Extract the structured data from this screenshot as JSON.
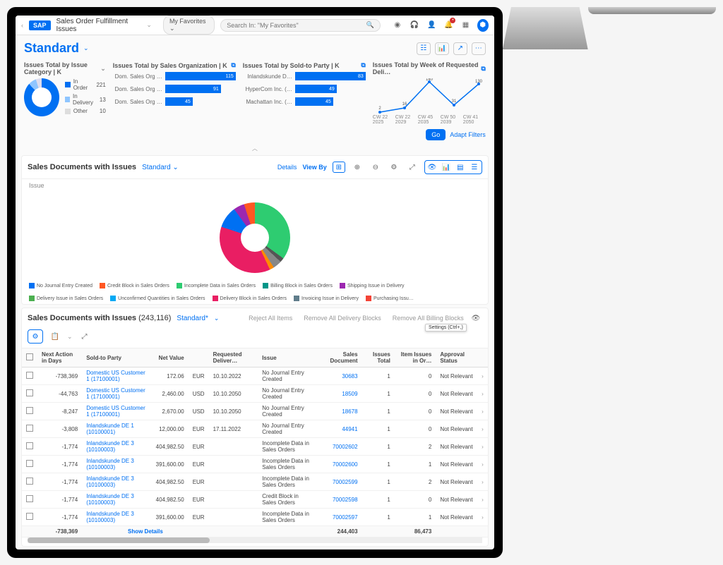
{
  "shell": {
    "app_title": "Sales Order Fulfillment Issues",
    "favorites_label": "My Favorites",
    "search_placeholder": "Search In: \"My Favorites\""
  },
  "page_title": "Standard",
  "chart_data": [
    {
      "type": "pie",
      "title": "Issues Total by Issue Category | K",
      "series": [
        {
          "name": "In Order",
          "value": 221,
          "color": "#0070f2"
        },
        {
          "name": "In Delivery",
          "value": 13,
          "color": "#8ec5ff"
        },
        {
          "name": "Other",
          "value": 10,
          "color": "#ddd"
        }
      ]
    },
    {
      "type": "bar",
      "title": "Issues Total by Sales Organization | K",
      "categories": [
        "Dom. Sales Org …",
        "Dom. Sales Org …",
        "Dom. Sales Org …"
      ],
      "values": [
        115,
        91,
        45
      ]
    },
    {
      "type": "bar",
      "title": "Issues Total by Sold-to Party | K",
      "categories": [
        "Inlandskunde D…",
        "HyperCom Inc. (…",
        "Machattan Inc. (…"
      ],
      "values": [
        83,
        49,
        45
      ]
    },
    {
      "type": "line",
      "title": "Issues Total by Week of Requested Deli…",
      "x": [
        "CW 22 2025",
        "CW 22 2029",
        "CW 45 2035",
        "CW 50 2039",
        "CW 41 2050"
      ],
      "values": [
        2,
        16,
        140,
        31,
        130
      ],
      "labels": [
        "2",
        "16",
        "140",
        "31",
        "130"
      ]
    }
  ],
  "filters": {
    "go": "Go",
    "adapt": "Adapt Filters"
  },
  "section1": {
    "title": "Sales Documents with Issues",
    "variant": "Standard",
    "details": "Details",
    "view_by": "View By",
    "issue_label": "Issue"
  },
  "donut_legend": [
    {
      "label": "No Journal Entry Created",
      "color": "#0070f2"
    },
    {
      "label": "Credit Block in Sales Orders",
      "color": "#ff5722"
    },
    {
      "label": "Incomplete Data in Sales Orders",
      "color": "#2ecc71"
    },
    {
      "label": "Billing Block in Sales Orders",
      "color": "#009688"
    },
    {
      "label": "Shipping Issue in Delivery",
      "color": "#9c27b0"
    },
    {
      "label": "Delivery Issue in Sales Orders",
      "color": "#4caf50"
    },
    {
      "label": "Unconfirmed Quantities in Sales Orders",
      "color": "#03a9f4"
    },
    {
      "label": "Delivery Block in Sales Orders",
      "color": "#e91e63"
    },
    {
      "label": "Invoicing Issue in Delivery",
      "color": "#607d8b"
    },
    {
      "label": "Purchasing Issu…",
      "color": "#f44336"
    }
  ],
  "table": {
    "title": "Sales Documents with Issues",
    "count": "(243,116)",
    "variant": "Standard",
    "reject": "Reject All Items",
    "remove_delivery": "Remove All Delivery Blocks",
    "remove_billing": "Remove All Billing Blocks",
    "tooltip": "Settings (Ctrl+,)",
    "columns": {
      "next_action": "Next Action in Days",
      "sold_to": "Sold-to Party",
      "net_value": "Net Value",
      "currency": "",
      "req_deliv": "Requested Deliver…",
      "issue": "Issue",
      "sales_doc": "Sales Document",
      "issues_total": "Issues Total",
      "item_issues": "Item Issues in Or…",
      "approval": "Approval Status"
    },
    "rows": [
      {
        "days": "-738,369",
        "party": "Domestic US Customer 1 (17100001)",
        "net": "172.06",
        "cur": "EUR",
        "date": "10.10.2022",
        "issue": "No Journal Entry Created",
        "doc": "30683",
        "tot": "1",
        "item": "0",
        "appr": "Not Relevant"
      },
      {
        "days": "-44,763",
        "party": "Domestic US Customer 1 (17100001)",
        "net": "2,460.00",
        "cur": "USD",
        "date": "10.10.2050",
        "issue": "No Journal Entry Created",
        "doc": "18509",
        "tot": "1",
        "item": "0",
        "appr": "Not Relevant"
      },
      {
        "days": "-8,247",
        "party": "Domestic US Customer 1 (17100001)",
        "net": "2,670.00",
        "cur": "USD",
        "date": "10.10.2050",
        "issue": "No Journal Entry Created",
        "doc": "18678",
        "tot": "1",
        "item": "0",
        "appr": "Not Relevant"
      },
      {
        "days": "-3,808",
        "party": "Inlandskunde DE 1 (10100001)",
        "net": "12,000.00",
        "cur": "EUR",
        "date": "17.11.2022",
        "issue": "No Journal Entry Created",
        "doc": "44941",
        "tot": "1",
        "item": "0",
        "appr": "Not Relevant"
      },
      {
        "days": "-1,774",
        "party": "Inlandskunde DE 3 (10100003)",
        "net": "404,982.50",
        "cur": "EUR",
        "date": "",
        "issue": "Incomplete Data in Sales Orders",
        "doc": "70002602",
        "tot": "1",
        "item": "2",
        "appr": "Not Relevant"
      },
      {
        "days": "-1,774",
        "party": "Inlandskunde DE 3 (10100003)",
        "net": "391,600.00",
        "cur": "EUR",
        "date": "",
        "issue": "Incomplete Data in Sales Orders",
        "doc": "70002600",
        "tot": "1",
        "item": "1",
        "appr": "Not Relevant"
      },
      {
        "days": "-1,774",
        "party": "Inlandskunde DE 3 (10100003)",
        "net": "404,982.50",
        "cur": "EUR",
        "date": "",
        "issue": "Incomplete Data in Sales Orders",
        "doc": "70002599",
        "tot": "1",
        "item": "2",
        "appr": "Not Relevant"
      },
      {
        "days": "-1,774",
        "party": "Inlandskunde DE 3 (10100003)",
        "net": "404,982.50",
        "cur": "EUR",
        "date": "",
        "issue": "Credit Block in Sales Orders",
        "doc": "70002598",
        "tot": "1",
        "item": "0",
        "appr": "Not Relevant"
      },
      {
        "days": "-1,774",
        "party": "Inlandskunde DE 3 (10100003)",
        "net": "391,600.00",
        "cur": "EUR",
        "date": "",
        "issue": "Incomplete Data in Sales Orders",
        "doc": "70002597",
        "tot": "1",
        "item": "1",
        "appr": "Not Relevant"
      }
    ],
    "totals": {
      "days": "-738,369",
      "sales_doc": "244,403",
      "item": "86,473"
    },
    "show_details": "Show Details"
  }
}
